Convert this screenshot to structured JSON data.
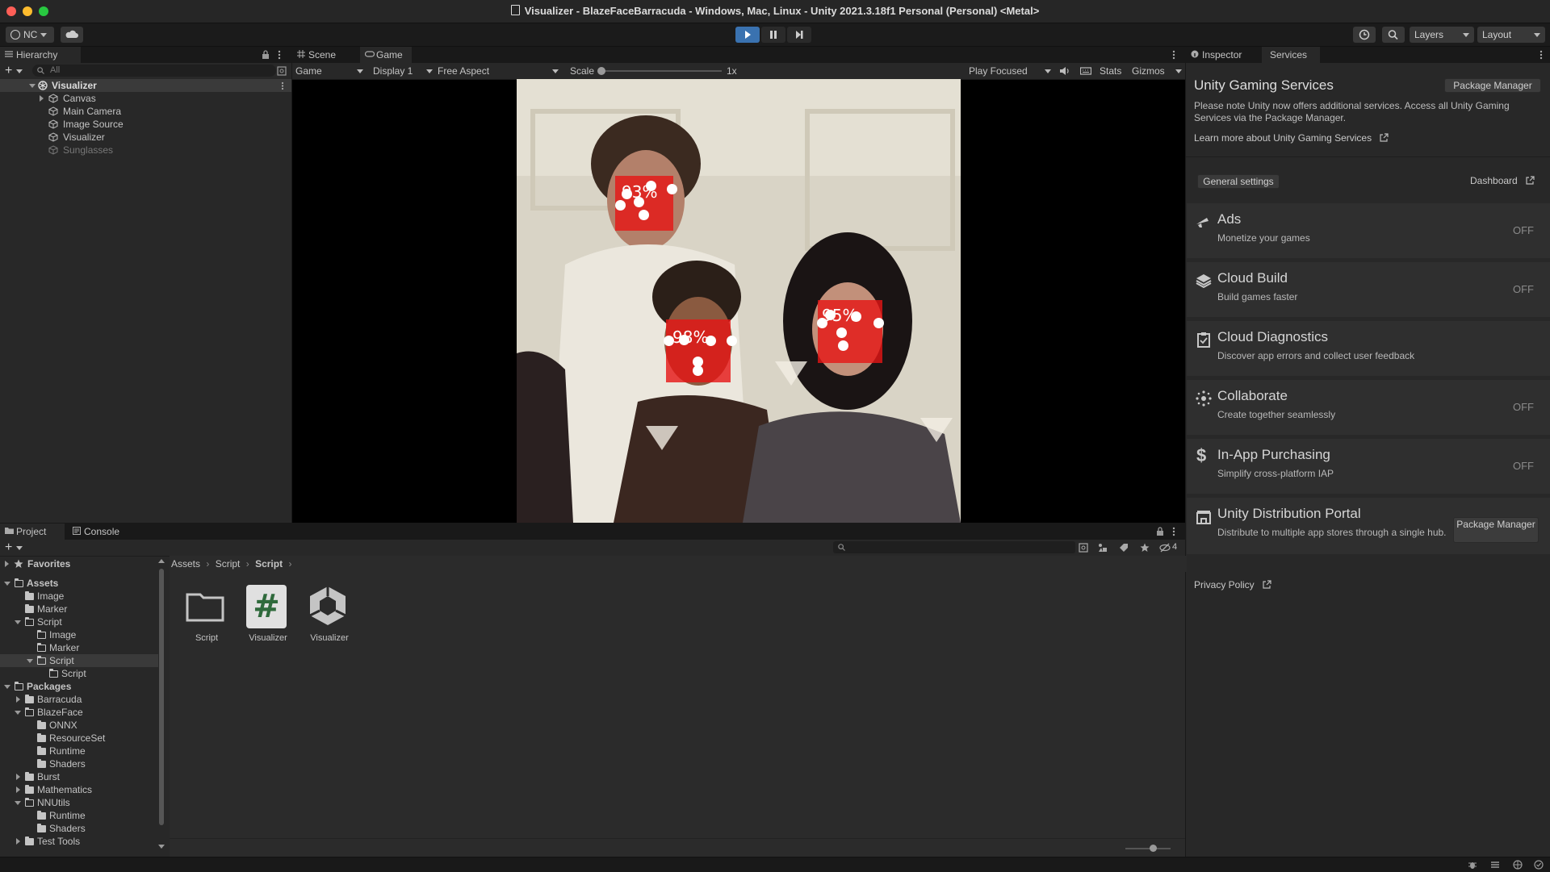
{
  "window": {
    "title": "Visualizer - BlazeFaceBarracuda - Windows, Mac, Linux - Unity 2021.3.18f1 Personal (Personal) <Metal>"
  },
  "toolbar": {
    "account": "NC",
    "layers": "Layers",
    "layout": "Layout"
  },
  "hierarchy": {
    "tab": "Hierarchy",
    "search_placeholder": "All",
    "root": "Visualizer",
    "items": [
      "Canvas",
      "Main Camera",
      "Image Source",
      "Visualizer",
      "Sunglasses"
    ]
  },
  "scene_tabs": {
    "scene": "Scene",
    "game": "Game"
  },
  "game_toolbar": {
    "mode": "Game",
    "display": "Display 1",
    "aspect": "Free Aspect",
    "scale_label": "Scale",
    "scale_value": "1x",
    "play_focused": "Play Focused",
    "stats": "Stats",
    "gizmos": "Gizmos"
  },
  "game_view": {
    "faces": [
      {
        "label": "93%"
      },
      {
        "label": "98%"
      },
      {
        "label": "95%"
      }
    ]
  },
  "project": {
    "tab_project": "Project",
    "tab_console": "Console",
    "favorites": "Favorites",
    "tree": [
      {
        "label": "Assets",
        "bold": true
      },
      {
        "label": "Image"
      },
      {
        "label": "Marker"
      },
      {
        "label": "Script"
      },
      {
        "label": "Image"
      },
      {
        "label": "Marker"
      },
      {
        "label": "Script"
      },
      {
        "label": "Script"
      },
      {
        "label": "Packages",
        "bold": true
      },
      {
        "label": "Barracuda"
      },
      {
        "label": "BlazeFace"
      },
      {
        "label": "ONNX"
      },
      {
        "label": "ResourceSet"
      },
      {
        "label": "Runtime"
      },
      {
        "label": "Shaders"
      },
      {
        "label": "Burst"
      },
      {
        "label": "Mathematics"
      },
      {
        "label": "NNUtils"
      },
      {
        "label": "Runtime"
      },
      {
        "label": "Shaders"
      },
      {
        "label": "Test Tools"
      }
    ],
    "breadcrumb": [
      "Assets",
      "Script",
      "Script"
    ],
    "assets": [
      "Script",
      "Visualizer",
      "Visualizer"
    ],
    "hidden_count": "4"
  },
  "inspector": {
    "tab_inspector": "Inspector",
    "tab_services": "Services",
    "heading": "Unity Gaming Services",
    "package_manager": "Package Manager",
    "note": "Please note Unity now offers additional services. Access all Unity Gaming Services via the Package Manager.",
    "learn_more": "Learn more about Unity Gaming Services",
    "general_settings": "General settings",
    "dashboard": "Dashboard",
    "services": [
      {
        "title": "Ads",
        "desc": "Monetize your games",
        "status": "OFF",
        "icon": "megaphone-icon"
      },
      {
        "title": "Cloud Build",
        "desc": "Build games faster",
        "status": "OFF",
        "icon": "layers-icon"
      },
      {
        "title": "Cloud Diagnostics",
        "desc": "Discover app errors and collect user feedback",
        "status": "",
        "icon": "clipboard-icon"
      },
      {
        "title": "Collaborate",
        "desc": "Create together seamlessly",
        "status": "OFF",
        "icon": "collaborate-icon"
      },
      {
        "title": "In-App Purchasing",
        "desc": "Simplify cross-platform IAP",
        "status": "OFF",
        "icon": "dollar-icon"
      },
      {
        "title": "Unity Distribution Portal",
        "desc": "Distribute to multiple app stores through a single hub.",
        "status": "",
        "icon": "store-icon"
      }
    ],
    "udp_button": "Package Manager",
    "privacy": "Privacy Policy"
  }
}
